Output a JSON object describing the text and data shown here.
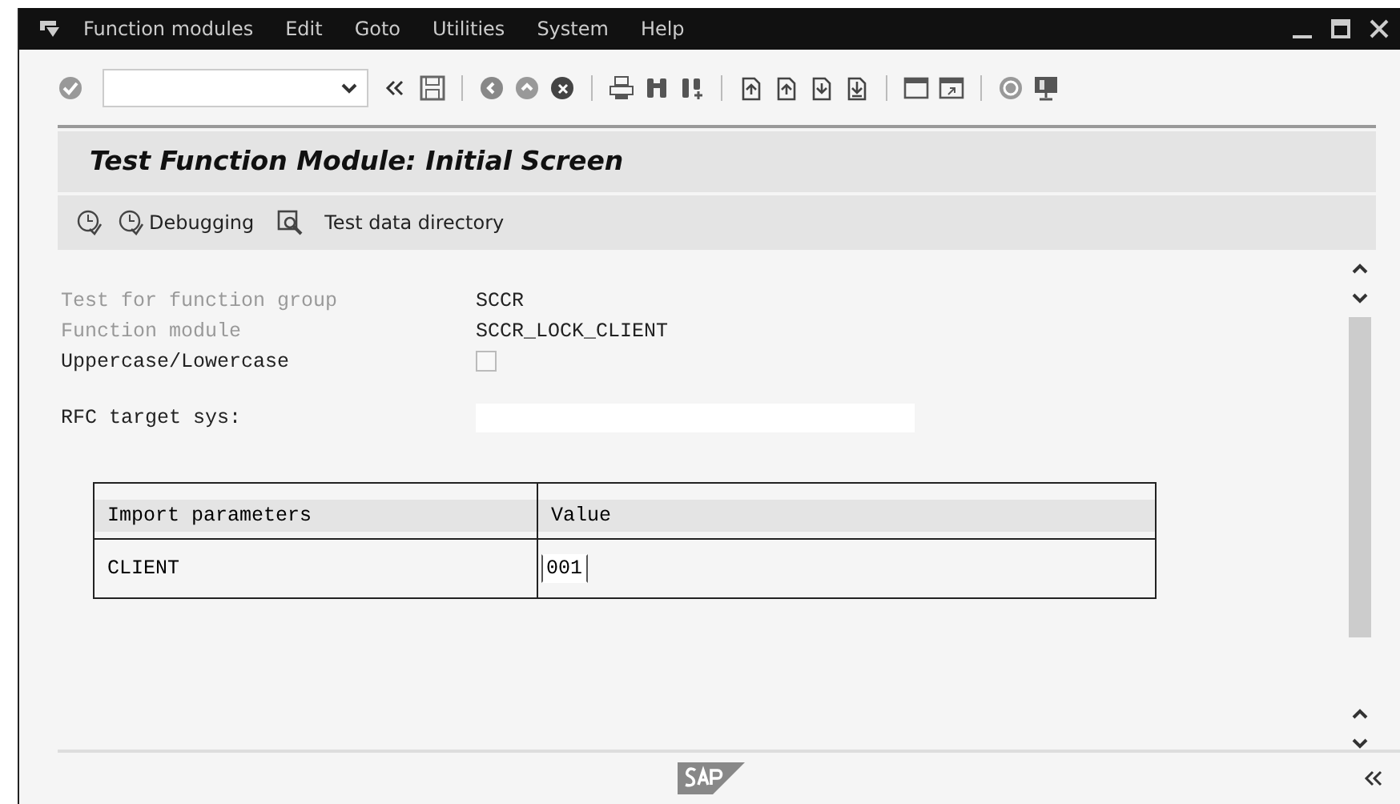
{
  "menu_bar": {
    "items": [
      "Function modules",
      "Edit",
      "Goto",
      "Utilities",
      "System",
      "Help"
    ]
  },
  "screen_title": "Test Function Module: Initial Screen",
  "app_toolbar": [
    {
      "kind": "icon-only"
    },
    {
      "label": "Debugging",
      "kind": "debug"
    },
    {
      "label": "Test data directory",
      "kind": "directory"
    }
  ],
  "fields": [
    {
      "label": "Test for function group",
      "value": "SCCR",
      "kind": "text",
      "disabled": true
    },
    {
      "label": "Function module",
      "value": "SCCR_LOCK_CLIENT",
      "kind": "text",
      "disabled": true
    },
    {
      "label": "Uppercase/Lowercase",
      "kind": "checkbox",
      "checked": false,
      "disabled": false
    },
    {
      "label": "RFC target sys:",
      "kind": "input",
      "disabled": false
    }
  ],
  "table": {
    "columns": [
      "Import parameters",
      "Value"
    ],
    "rows": [
      [
        "CLIENT",
        "001"
      ]
    ]
  }
}
